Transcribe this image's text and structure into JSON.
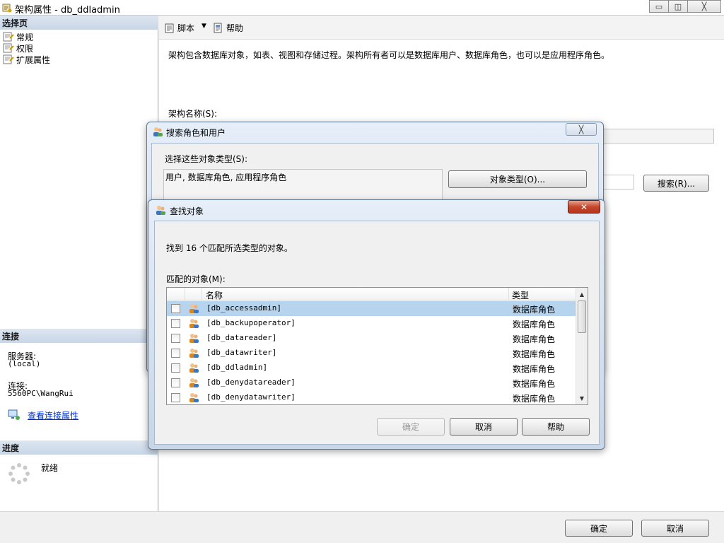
{
  "window": {
    "title": "架构属性 - db_ddladmin",
    "minimize": "▭",
    "restore": "◫",
    "close": "╳"
  },
  "left": {
    "select_page_header": "选择页",
    "nav_items": [
      "常规",
      "权限",
      "扩展属性"
    ],
    "connection_header": "连接",
    "server_label": "服务器:",
    "server_value": "(local)",
    "connection_label": "连接:",
    "connection_value": "5560PC\\WangRui",
    "view_link": "查看连接属性",
    "progress_header": "进度",
    "progress_status": "就绪"
  },
  "toolbar": {
    "script_label": "脚本",
    "help_label": "帮助"
  },
  "main": {
    "description": "架构包含数据库对象，如表、视图和存储过程。架构所有者可以是数据库用户、数据库角色，也可以是应用程序角色。",
    "schema_name_label": "架构名称(S):",
    "search_button": "搜索(R)..."
  },
  "footer": {
    "ok": "确定",
    "cancel": "取消"
  },
  "search_dialog": {
    "title": "搜索角色和用户",
    "close": "╳",
    "object_types_label": "选择这些对象类型(S):",
    "object_types_value": "用户, 数据库角色, 应用程序角色",
    "object_types_button": "对象类型(O)..."
  },
  "find_dialog": {
    "title": "查找对象",
    "close": "✕",
    "found_text": "找到 16 个匹配所选类型的对象。",
    "matched_label": "匹配的对象(M):",
    "columns": {
      "name": "名称",
      "type": "类型"
    },
    "rows": [
      {
        "name": "[db_accessadmin]",
        "type": "数据库角色",
        "selected": true
      },
      {
        "name": "[db_backupoperator]",
        "type": "数据库角色"
      },
      {
        "name": "[db_datareader]",
        "type": "数据库角色"
      },
      {
        "name": "[db_datawriter]",
        "type": "数据库角色"
      },
      {
        "name": "[db_ddladmin]",
        "type": "数据库角色"
      },
      {
        "name": "[db_denydatareader]",
        "type": "数据库角色"
      },
      {
        "name": "[db_denydatawriter]",
        "type": "数据库角色"
      }
    ],
    "ok": "确定",
    "cancel": "取消",
    "help": "帮助"
  }
}
